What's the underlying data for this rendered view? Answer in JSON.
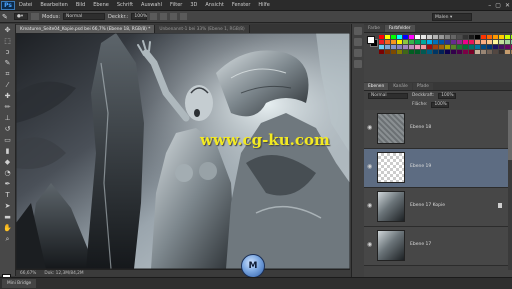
{
  "app": {
    "logo": "Ps"
  },
  "menu": [
    "Datei",
    "Bearbeiten",
    "Bild",
    "Ebene",
    "Schrift",
    "Auswahl",
    "Filter",
    "3D",
    "Ansicht",
    "Fenster",
    "Hilfe"
  ],
  "window_controls": [
    "–",
    "▢",
    "✕"
  ],
  "options_bar": {
    "mode_label": "Modus:",
    "mode_value": "Normal",
    "opacity_label": "Deckkr.:",
    "opacity_value": "100%"
  },
  "workspace": {
    "value": "Malen"
  },
  "tools": [
    "move-icon",
    "marquee-icon",
    "lasso-icon",
    "quick-select-icon",
    "crop-icon",
    "eyedropper-icon",
    "heal-icon",
    "brush-icon",
    "stamp-icon",
    "history-brush-icon",
    "eraser-icon",
    "gradient-icon",
    "blur-icon",
    "dodge-icon",
    "pen-icon",
    "type-icon",
    "path-select-icon",
    "shape-icon",
    "hand-icon",
    "zoom-icon"
  ],
  "doc_tabs": [
    {
      "label": "Kreaturen_Seite04_Kopie.psd bei 66,7% (Ebene 18, RGB/8) *",
      "active": true
    },
    {
      "label": "Unbenannt-1 bei 33% (Ebene 1, RGB/8)",
      "active": false
    }
  ],
  "status": {
    "zoom": "66,67%",
    "doc": "Dok: 12,3M/84,2M"
  },
  "bottom_tab": "Mini Bridge",
  "panel_tabs": {
    "top": [
      "Farbe",
      "Farbfelder"
    ],
    "layers": [
      "Ebenen",
      "Kanäle",
      "Pfade"
    ]
  },
  "layers_options": {
    "blend": "Normal",
    "opacity_label": "Deckkraft:",
    "opacity": "100%",
    "fill_label": "Fläche:",
    "fill": "100%"
  },
  "layers": [
    {
      "name": "Ebene 18",
      "selected": false,
      "thumb": "texture",
      "fx": false
    },
    {
      "name": "Ebene 19",
      "selected": true,
      "thumb": "transparent",
      "fx": false
    },
    {
      "name": "Ebene 17 Kopie",
      "selected": false,
      "thumb": "statue",
      "fx": true
    },
    {
      "name": "Ebene 17",
      "selected": false,
      "thumb": "statue",
      "fx": false
    }
  ],
  "watermark": {
    "text": "www.cg-ku.com",
    "logo": "M"
  },
  "swatch_colors": [
    "#ff0000",
    "#ffff00",
    "#00ff00",
    "#00ffff",
    "#0000ff",
    "#ff00ff",
    "#ffffff",
    "#e6e6e6",
    "#cccccc",
    "#b3b3b3",
    "#999999",
    "#808080",
    "#666666",
    "#4d4d4d",
    "#333333",
    "#1a1a1a",
    "#000000",
    "#ff3300",
    "#ff6600",
    "#ff9900",
    "#ffcc00",
    "#ccff00",
    "#99ff00",
    "#66ff00",
    "#ed1c24",
    "#f26522",
    "#f7941d",
    "#fff200",
    "#8dc63f",
    "#39b54a",
    "#00a651",
    "#00a99d",
    "#00aeef",
    "#0072bc",
    "#0054a6",
    "#2e3192",
    "#662d91",
    "#92278f",
    "#ec008c",
    "#ed145b",
    "#f69679",
    "#f9ad81",
    "#fdc689",
    "#fff799",
    "#c4df9b",
    "#a3d39c",
    "#82ca9c",
    "#7accc8",
    "#6dcff6",
    "#7da7d9",
    "#8393ca",
    "#8781bd",
    "#a186be",
    "#bd8cbf",
    "#f49ac1",
    "#f5989d",
    "#9e0b0f",
    "#a0410d",
    "#a36209",
    "#aba000",
    "#598527",
    "#1a7b30",
    "#007236",
    "#00746b",
    "#0076a3",
    "#004a80",
    "#003471",
    "#1b1464",
    "#440e62",
    "#630460",
    "#9e005d",
    "#9e0039",
    "#790000",
    "#7b2e00",
    "#7d4900",
    "#827b00",
    "#406618",
    "#005e20",
    "#005826",
    "#005952",
    "#005b7f",
    "#003663",
    "#002157",
    "#0d004c",
    "#32004b",
    "#4b0049",
    "#7b0046",
    "#7a0026",
    "#c7b299",
    "#998675",
    "#736357",
    "#534741",
    "#37302d",
    "#c69c6d",
    "#a67c52",
    "#8c6239"
  ]
}
